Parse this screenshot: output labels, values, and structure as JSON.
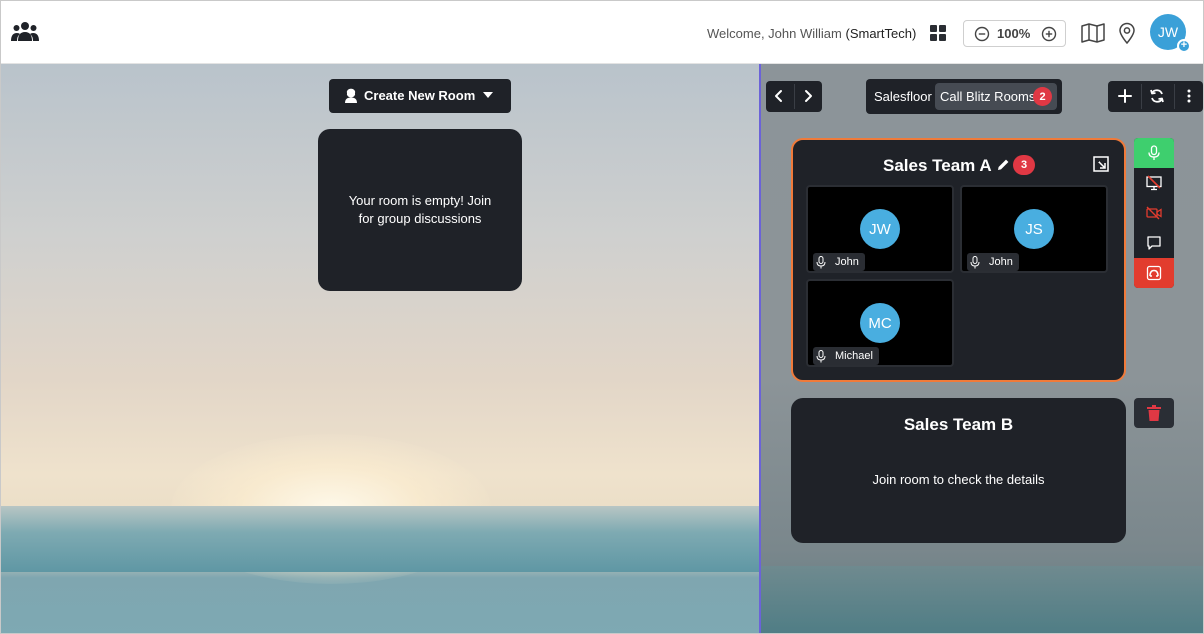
{
  "header": {
    "welcome_prefix": "Welcome, John William",
    "org": "(SmartTech)",
    "zoom": "100%",
    "avatar_initials": "JW",
    "avatar_add": "+"
  },
  "left": {
    "create_room_label": "Create New Room",
    "empty_room_text": "Your room is empty! Join for group discussions"
  },
  "right": {
    "tabs": [
      {
        "label": "Salesfloor"
      },
      {
        "label": "Call Blitz Rooms",
        "badge": "2"
      }
    ],
    "rooms": [
      {
        "name": "Sales Team A",
        "count": "3",
        "participants": [
          {
            "initials": "JW",
            "name": "John"
          },
          {
            "initials": "JS",
            "name": "John"
          },
          {
            "initials": "MC",
            "name": "Michael"
          }
        ]
      },
      {
        "name": "Sales Team B",
        "message": "Join room to check the details"
      }
    ]
  },
  "colors": {
    "accent_orange": "#f07a3a",
    "badge_red": "#e03844",
    "mic_green": "#3ecf6e",
    "leave_red": "#e23c2e",
    "avatar_blue": "#49aee0",
    "divider_purple": "#6b63d8"
  },
  "icons": {
    "header": [
      "group-icon",
      "grid-icon",
      "zoom-out-icon",
      "zoom-in-icon",
      "map-book-icon",
      "location-pin-icon"
    ],
    "room_controls": [
      "microphone-icon",
      "screen-share-off-icon",
      "camera-off-icon",
      "chat-icon",
      "leave-room-icon"
    ],
    "tools": [
      "plus-icon",
      "refresh-icon",
      "more-vertical-icon"
    ]
  }
}
